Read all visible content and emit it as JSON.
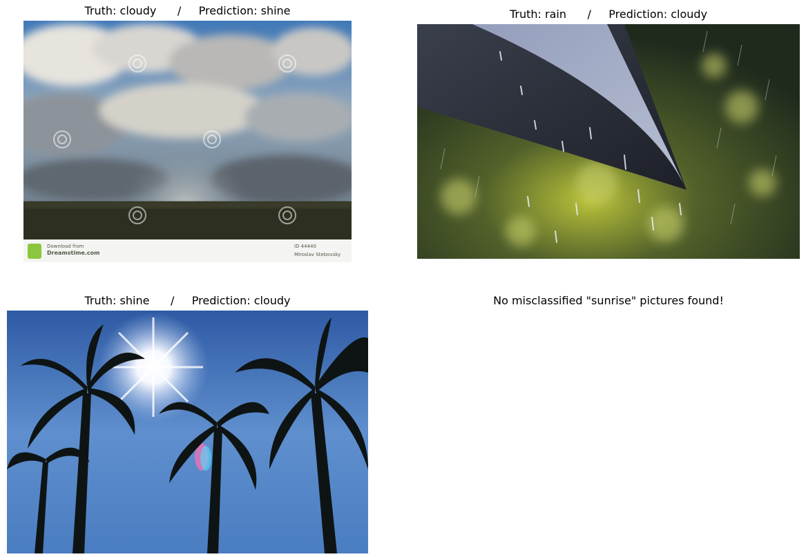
{
  "panels": [
    {
      "truth": "cloudy",
      "prediction": "shine",
      "title": "Truth: cloudy      /     Prediction: shine",
      "image": "cloudy-sky-photo",
      "watermark": {
        "line1": "Download from",
        "line2": "Dreamstime.com",
        "right1": "ID 44440",
        "right2": "Miroslav Stebovsky"
      }
    },
    {
      "truth": "rain",
      "prediction": "cloudy",
      "title": "Truth: rain      /     Prediction: cloudy",
      "image": "rain-umbrella-photo"
    },
    {
      "truth": "shine",
      "prediction": "cloudy",
      "title": "Truth: shine      /     Prediction: cloudy",
      "image": "sun-palm-trees-photo"
    },
    {
      "message": "No misclassified \"sunrise\" pictures found!"
    }
  ]
}
